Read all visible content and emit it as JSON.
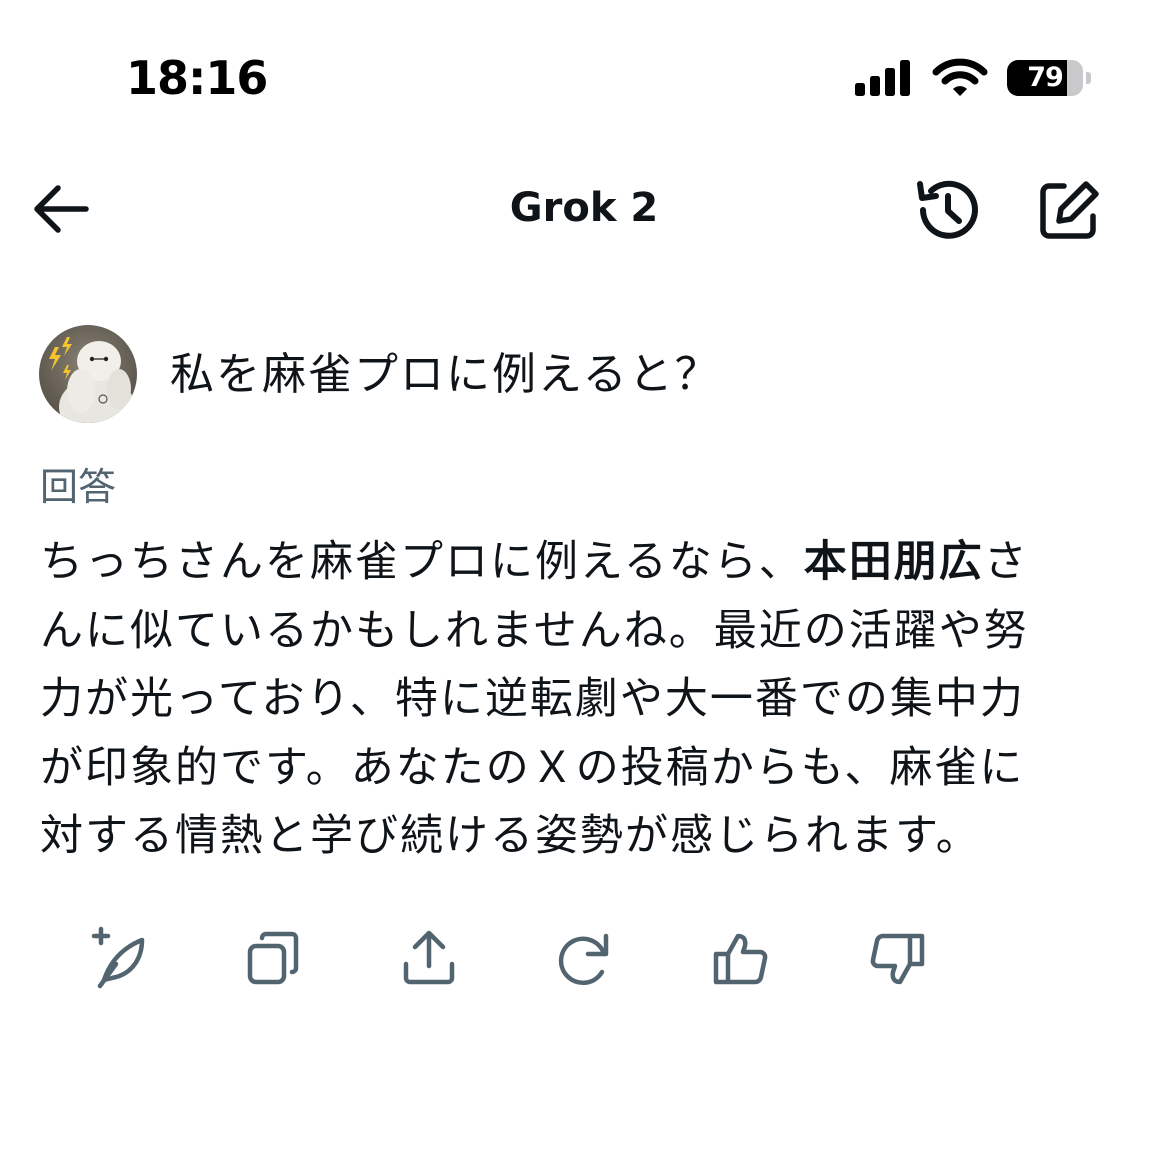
{
  "status_bar": {
    "time": "18:16",
    "battery_level": "79",
    "battery_fraction": 0.79,
    "signal_icon": "cellular-signal-icon",
    "wifi_icon": "wifi-icon"
  },
  "header": {
    "title": "Grok 2",
    "back_icon": "arrow-left-icon",
    "history_icon": "history-icon",
    "compose_icon": "compose-icon"
  },
  "question": {
    "avatar_icon": "user-avatar",
    "text": "私を麻雀プロに例えると？"
  },
  "answer": {
    "label": "回答",
    "line1_before": "ちっちさんを麻雀プロに例えるなら、",
    "line1_bold": "本田朋広",
    "line1_after": "さ",
    "line2": "んに似ているかもしれませんね。最近の活躍や努",
    "line3": "力が光っており、特に逆転劇や大一番での集中力",
    "line4": "が印象的です。あなたのＸの投稿からも、麻雀に",
    "line5": "対する情熱と学び続ける姿勢が感じられます。"
  },
  "actions": [
    {
      "name": "regenerate-with-feather-button",
      "icon": "feather-plus-icon"
    },
    {
      "name": "copy-button",
      "icon": "copy-icon"
    },
    {
      "name": "share-button",
      "icon": "share-icon"
    },
    {
      "name": "refresh-button",
      "icon": "refresh-icon"
    },
    {
      "name": "thumbs-up-button",
      "icon": "thumbs-up-icon"
    },
    {
      "name": "thumbs-down-button",
      "icon": "thumbs-down-icon"
    }
  ],
  "colors": {
    "text_primary": "#0f1419",
    "text_secondary": "#536471",
    "action_icon": "#536471",
    "background": "#ffffff"
  }
}
